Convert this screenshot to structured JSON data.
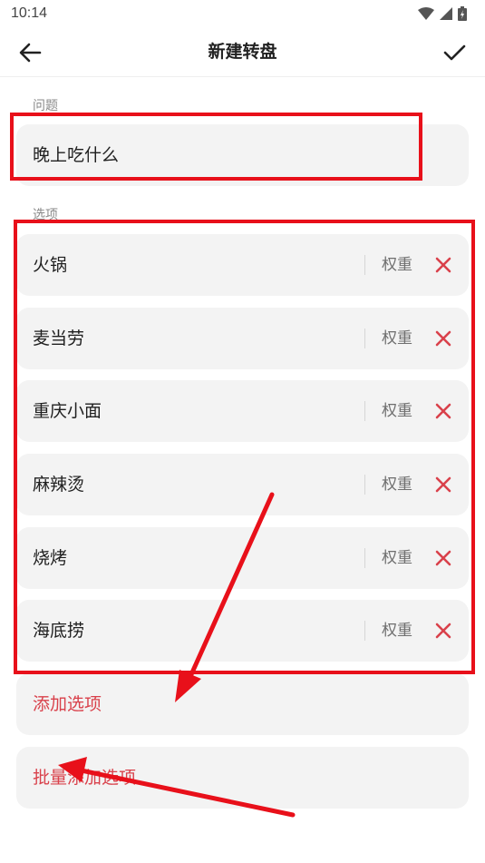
{
  "status_bar": {
    "time": "10:14",
    "icons": [
      "wifi-icon",
      "cellular-signal-icon",
      "battery-icon"
    ]
  },
  "app_bar": {
    "title": "新建转盘",
    "back_icon": "arrow-left-icon",
    "confirm_icon": "check-icon"
  },
  "question": {
    "label": "问题",
    "value": "晚上吃什么"
  },
  "options": {
    "label": "选项",
    "weight_label": "权重",
    "remove_icon": "close-icon",
    "items": [
      {
        "label": "火锅"
      },
      {
        "label": "麦当劳"
      },
      {
        "label": "重庆小面"
      },
      {
        "label": "麻辣烫"
      },
      {
        "label": "烧烤"
      },
      {
        "label": "海底捞"
      }
    ]
  },
  "actions": {
    "add_option": "添加选项",
    "batch_add_option": "批量添加选项"
  },
  "colors": {
    "accent_red": "#d9414b",
    "annotation_red": "#e8101a",
    "field_background": "#f3f3f3"
  }
}
